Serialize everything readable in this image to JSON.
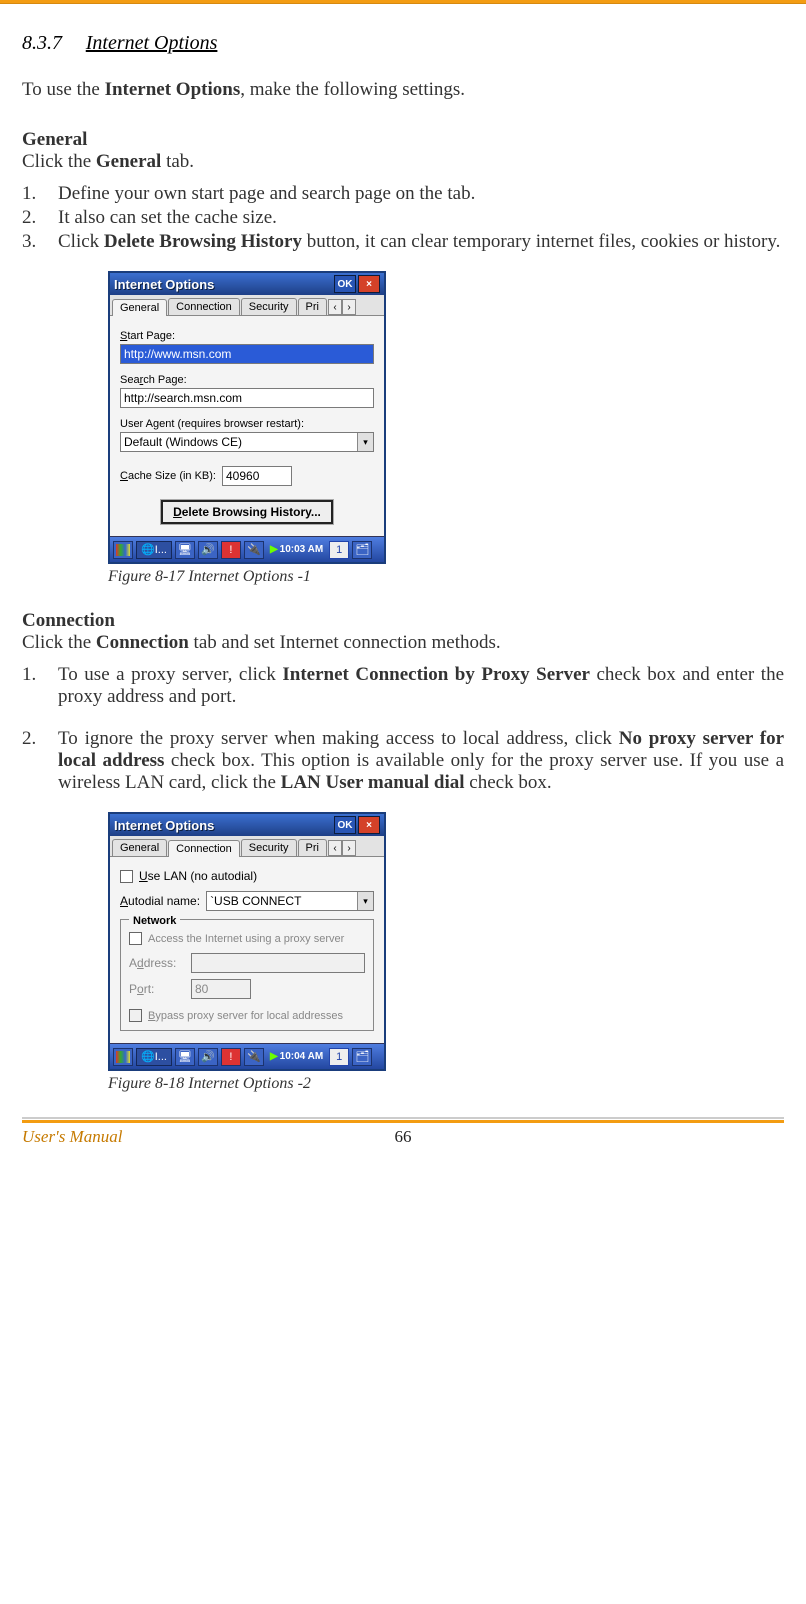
{
  "section": {
    "number": "8.3.7",
    "title": "Internet Options"
  },
  "intro_pre": "To use the ",
  "intro_bold": "Internet Options",
  "intro_post": ", make the following settings.",
  "general": {
    "heading": "General",
    "line_pre": "Click the ",
    "line_bold": "General",
    "line_post": " tab.",
    "items": [
      "Define your own start page and search page on the tab.",
      "It also can set the cache size."
    ],
    "item3_pre": "Click ",
    "item3_bold": "Delete Browsing History",
    "item3_post": " button, it can clear temporary internet files, cookies or history."
  },
  "fig1": {
    "title": "Internet Options",
    "ok": "OK",
    "x": "×",
    "tabs": [
      "General",
      "Connection",
      "Security",
      "Pri"
    ],
    "start_label": "Start Page:",
    "start_value": "http://www.msn.com",
    "search_label": "Search Page:",
    "search_value": "http://search.msn.com",
    "ua_label": "User Agent (requires browser restart):",
    "ua_value": "Default (Windows CE)",
    "cache_label": "Cache Size (in KB):",
    "cache_value": "40960",
    "delete_btn": "Delete Browsing History...",
    "task_app": "I...",
    "time": "10:03 AM",
    "tray_badge": "1",
    "caption": "Figure 8-17 Internet Options -1"
  },
  "connection": {
    "heading": "Connection",
    "line_pre": "Click the ",
    "line_bold": "Connection",
    "line_post": " tab and set Internet connection methods.",
    "item1_pre": "To use a proxy server, click ",
    "item1_bold": "Internet Connection by Proxy Server",
    "item1_post": " check box and enter the proxy address and port.",
    "item2_pre": "To ignore the proxy server when making access to local address, click ",
    "item2_bold1": "No proxy server for local address",
    "item2_mid": " check box. This option is available only for the proxy server use. If you use a wireless LAN card, click the ",
    "item2_bold2": "LAN User manual dial",
    "item2_post": " check box."
  },
  "fig2": {
    "title": "Internet Options",
    "ok": "OK",
    "x": "×",
    "tabs": [
      "General",
      "Connection",
      "Security",
      "Pri"
    ],
    "use_lan": "Use LAN (no autodial)",
    "autodial_label": "Autodial name:",
    "autodial_value": "`USB CONNECT",
    "network_legend": "Network",
    "proxy_label": "Access the Internet using a proxy server",
    "address_label": "Address:",
    "address_value": "",
    "port_label": "Port:",
    "port_value": "80",
    "bypass_label": "Bypass proxy server for local addresses",
    "task_app": "I...",
    "time": "10:04 AM",
    "tray_badge": "1",
    "caption": "Figure 8-18 Internet Options -2"
  },
  "footer": {
    "manual": "User's Manual",
    "page": "66"
  }
}
